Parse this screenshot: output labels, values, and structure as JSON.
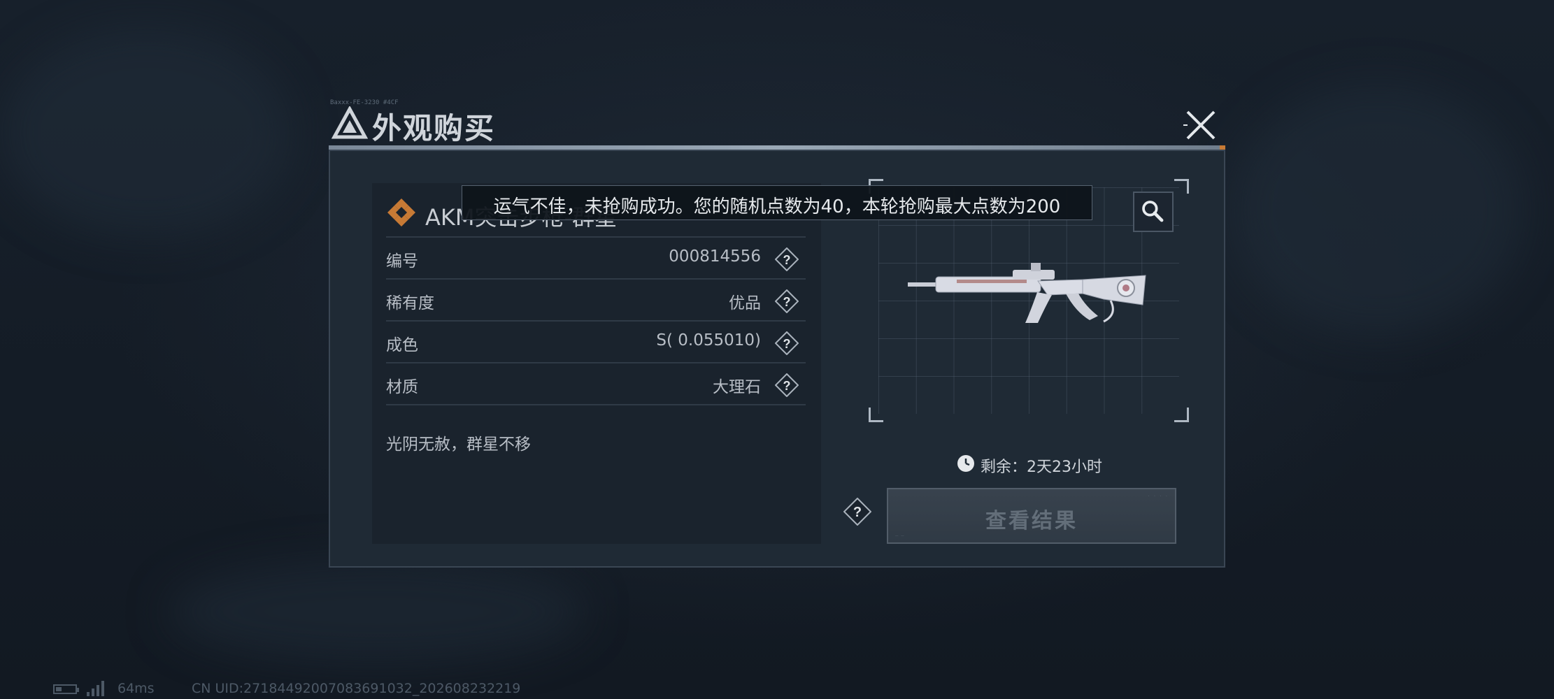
{
  "dialog": {
    "title": "外观购买",
    "title_small": "Baxxx-FE-3230 #4CF"
  },
  "toast": {
    "message": "运气不佳，未抢购成功。您的随机点数为40，本轮抢购最大点数为200"
  },
  "item": {
    "name": "AKM突击步枪-群星",
    "rows": [
      {
        "label": "编号",
        "value": "000814556"
      },
      {
        "label": "稀有度",
        "value": "优品"
      },
      {
        "label": "成色",
        "value": "S( 0.055010)"
      },
      {
        "label": "材质",
        "value": "大理石"
      }
    ],
    "description": "光阴无赦，群星不移"
  },
  "preview": {
    "timer_text": "剩余：2天23小时"
  },
  "actions": {
    "result_label": "查看结果"
  },
  "status_bar": {
    "ping": "64ms",
    "uid": "CN UID:2718449200708369103​2_202608232219"
  },
  "colors": {
    "background": "#141c26",
    "panel": "#1f2a35",
    "accent_orange": "#c77a35",
    "text": "#d8dde3"
  },
  "icons": {
    "title_logo": "triangle-logo-icon",
    "close": "close-icon",
    "zoom": "magnifier-icon",
    "help": "question-diamond-icon",
    "timer": "clock-icon",
    "item_rarity": "diamond-cluster-icon"
  }
}
